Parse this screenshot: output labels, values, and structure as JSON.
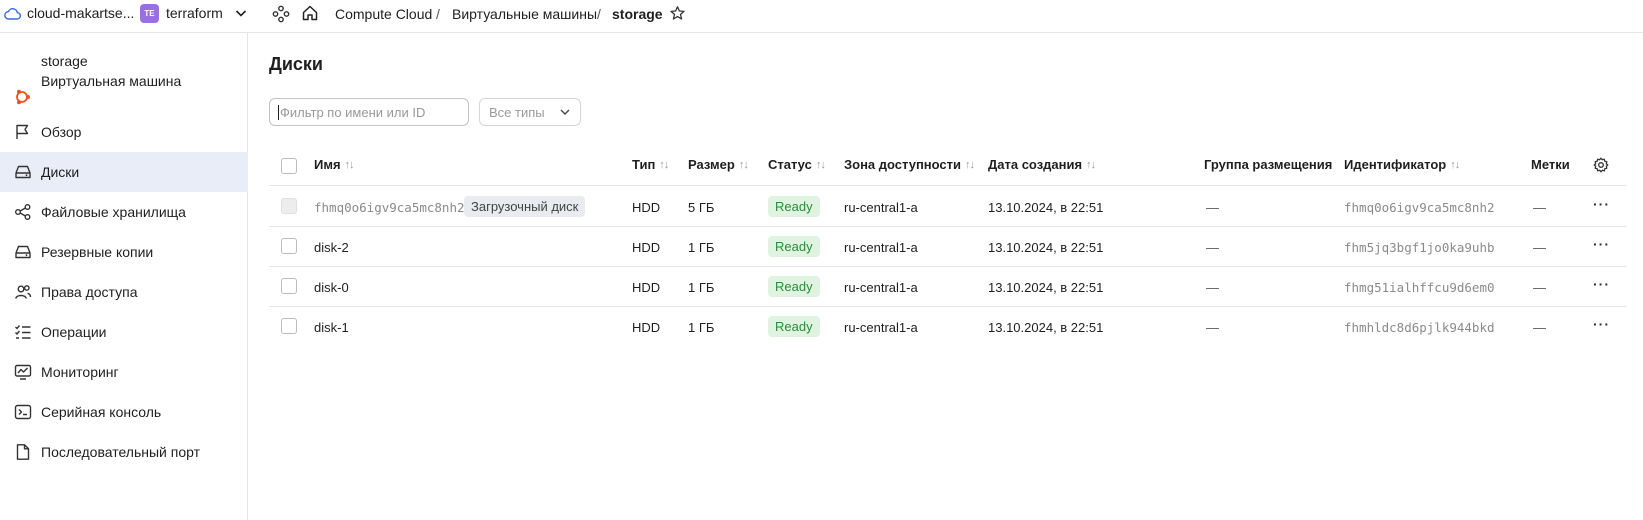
{
  "topbar": {
    "cloud_name": "cloud-makartse...",
    "folder_badge": "TE",
    "folder_name": "terraform",
    "breadcrumbs": [
      "Compute Cloud",
      "Виртуальные машины",
      "storage"
    ]
  },
  "sidebar": {
    "vm_name": "storage",
    "vm_type": "Виртуальная машина",
    "items": [
      {
        "label": "Обзор",
        "icon": "flag-icon"
      },
      {
        "label": "Диски",
        "icon": "disk-icon"
      },
      {
        "label": "Файловые хранилища",
        "icon": "share-nodes-icon"
      },
      {
        "label": "Резервные копии",
        "icon": "backup-disk-icon"
      },
      {
        "label": "Права доступа",
        "icon": "users-icon"
      },
      {
        "label": "Операции",
        "icon": "checklist-icon"
      },
      {
        "label": "Мониторинг",
        "icon": "monitor-chart-icon"
      },
      {
        "label": "Серийная консоль",
        "icon": "terminal-icon"
      },
      {
        "label": "Последовательный порт",
        "icon": "document-icon"
      }
    ],
    "active_index": 1
  },
  "main": {
    "title": "Диски",
    "filter_placeholder": "Фильтр по имени или ID",
    "type_select": "Все типы",
    "columns": {
      "name": "Имя",
      "type": "Тип",
      "size": "Размер",
      "status": "Статус",
      "zone": "Зона доступности",
      "created": "Дата создания",
      "group": "Группа размещения",
      "id": "Идентификатор",
      "labels": "Метки"
    },
    "rows": [
      {
        "name": "fhmq0o6igv9ca5mc8nh2",
        "boot_label": "Загрузочный диск",
        "type": "HDD",
        "size": "5 ГБ",
        "status": "Ready",
        "zone": "ru-central1-a",
        "created": "13.10.2024, в 22:51",
        "group": "—",
        "id": "fhmq0o6igv9ca5mc8nh2",
        "labels": "—"
      },
      {
        "name": "disk-2",
        "type": "HDD",
        "size": "1 ГБ",
        "status": "Ready",
        "zone": "ru-central1-a",
        "created": "13.10.2024, в 22:51",
        "group": "—",
        "id": "fhm5jq3bgf1jo0ka9uhb",
        "labels": "—"
      },
      {
        "name": "disk-0",
        "type": "HDD",
        "size": "1 ГБ",
        "status": "Ready",
        "zone": "ru-central1-a",
        "created": "13.10.2024, в 22:51",
        "group": "—",
        "id": "fhmg51ialhffcu9d6em0",
        "labels": "—"
      },
      {
        "name": "disk-1",
        "type": "HDD",
        "size": "1 ГБ",
        "status": "Ready",
        "zone": "ru-central1-a",
        "created": "13.10.2024, в 22:51",
        "group": "—",
        "id": "fhmhldc8d6pjlk944bkd",
        "labels": "—"
      }
    ]
  }
}
